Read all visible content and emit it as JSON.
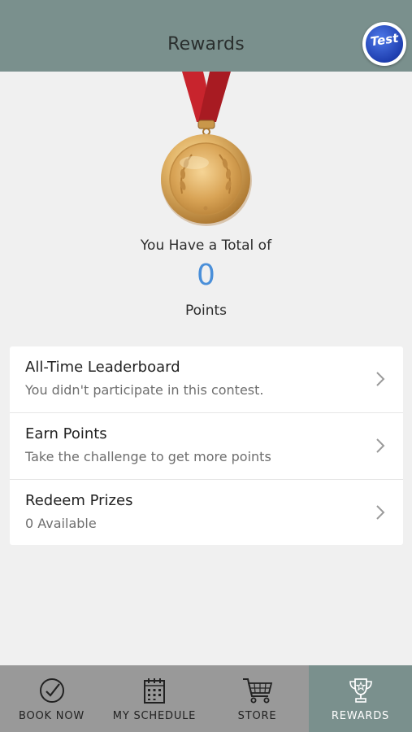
{
  "header": {
    "title": "Rewards",
    "avatar_text": "Test"
  },
  "summary": {
    "total_label": "You Have a Total of",
    "points_value": "0",
    "points_unit": "Points"
  },
  "menu": [
    {
      "title": "All-Time Leaderboard",
      "subtitle": "You didn't participate in this contest."
    },
    {
      "title": "Earn Points",
      "subtitle": "Take the challenge to get more points"
    },
    {
      "title": "Redeem Prizes",
      "subtitle": "0 Available"
    }
  ],
  "tabs": [
    {
      "label": "BOOK NOW",
      "icon": "check-circle-icon"
    },
    {
      "label": "MY SCHEDULE",
      "icon": "calendar-icon"
    },
    {
      "label": "STORE",
      "icon": "cart-icon"
    },
    {
      "label": "REWARDS",
      "icon": "trophy-icon",
      "active": true
    }
  ],
  "colors": {
    "header_bg": "#7a908d",
    "points_accent": "#4a8fd9",
    "tabbar_bg": "#999999",
    "tab_active_bg": "#7a908d"
  }
}
